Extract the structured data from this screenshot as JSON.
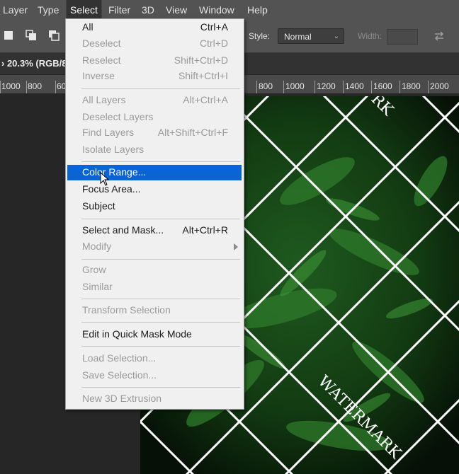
{
  "menubar": {
    "items": [
      {
        "label": "Layer"
      },
      {
        "label": "Type"
      },
      {
        "label": "Select"
      },
      {
        "label": "Filter"
      },
      {
        "label": "3D"
      },
      {
        "label": "View"
      },
      {
        "label": "Window"
      },
      {
        "label": "Help"
      }
    ],
    "active": "Select"
  },
  "options": {
    "style_label": "Style:",
    "style_value": "Normal",
    "width_label": "Width:"
  },
  "document": {
    "title": "20.3% (RGB/8"
  },
  "ruler": {
    "left_ticks": [
      "1000",
      "800",
      "60"
    ],
    "right_ticks": [
      "800",
      "1000",
      "1200",
      "1400",
      "1600",
      "1800",
      "2000"
    ]
  },
  "canvas": {
    "watermark_texts": [
      "RK",
      "WATERMARK"
    ]
  },
  "select_menu": {
    "items": [
      {
        "label": "All",
        "shortcut": "Ctrl+A",
        "enabled": true
      },
      {
        "label": "Deselect",
        "shortcut": "Ctrl+D",
        "enabled": false
      },
      {
        "label": "Reselect",
        "shortcut": "Shift+Ctrl+D",
        "enabled": false
      },
      {
        "label": "Inverse",
        "shortcut": "Shift+Ctrl+I",
        "enabled": false
      },
      {
        "label": "All Layers",
        "shortcut": "Alt+Ctrl+A",
        "enabled": false
      },
      {
        "label": "Deselect Layers",
        "shortcut": "",
        "enabled": false
      },
      {
        "label": "Find Layers",
        "shortcut": "Alt+Shift+Ctrl+F",
        "enabled": false
      },
      {
        "label": "Isolate Layers",
        "shortcut": "",
        "enabled": false
      },
      {
        "label": "Color Range...",
        "shortcut": "",
        "enabled": true,
        "highlighted": true
      },
      {
        "label": "Focus Area...",
        "shortcut": "",
        "enabled": true
      },
      {
        "label": "Subject",
        "shortcut": "",
        "enabled": true
      },
      {
        "label": "Select and Mask...",
        "shortcut": "Alt+Ctrl+R",
        "enabled": true
      },
      {
        "label": "Modify",
        "shortcut": "",
        "enabled": false,
        "submenu": true
      },
      {
        "label": "Grow",
        "shortcut": "",
        "enabled": false
      },
      {
        "label": "Similar",
        "shortcut": "",
        "enabled": false
      },
      {
        "label": "Transform Selection",
        "shortcut": "",
        "enabled": false
      },
      {
        "label": "Edit in Quick Mask Mode",
        "shortcut": "",
        "enabled": true
      },
      {
        "label": "Load Selection...",
        "shortcut": "",
        "enabled": false
      },
      {
        "label": "Save Selection...",
        "shortcut": "",
        "enabled": false
      },
      {
        "label": "New 3D Extrusion",
        "shortcut": "",
        "enabled": false
      }
    ]
  },
  "colors": {
    "menu_highlight": "#0a64d6",
    "menubar_bg": "#535353",
    "menu_bg": "#f0f0f0",
    "disabled_text": "#9a9a9a"
  }
}
